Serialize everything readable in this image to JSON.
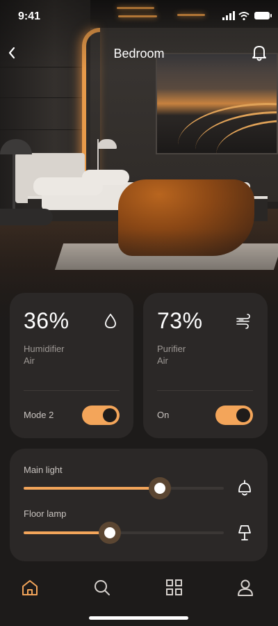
{
  "status_bar": {
    "time": "9:41"
  },
  "header": {
    "title": "Bedroom"
  },
  "devices": [
    {
      "value": "36%",
      "name_line1": "Humidifier",
      "name_line2": "Air",
      "icon": "droplet-icon",
      "mode_text": "Mode 2",
      "toggle_on": true
    },
    {
      "value": "73%",
      "name_line1": "Purifier",
      "name_line2": "Air",
      "icon": "wind-icon",
      "mode_text": "On",
      "toggle_on": true
    }
  ],
  "lights": [
    {
      "label": "Main light",
      "level_percent": 68,
      "icon": "ceiling-lamp-icon"
    },
    {
      "label": "Floor lamp",
      "level_percent": 43,
      "icon": "floor-lamp-icon"
    }
  ],
  "bottom_nav": [
    {
      "name": "home",
      "icon": "home-icon",
      "active": true
    },
    {
      "name": "search",
      "icon": "search-icon",
      "active": false
    },
    {
      "name": "apps",
      "icon": "grid-icon",
      "active": false
    },
    {
      "name": "profile",
      "icon": "user-icon",
      "active": false
    }
  ],
  "colors": {
    "accent": "#f3a55a",
    "card": "#2b2827",
    "background": "#1d1b1a",
    "inactive_icon": "#d7d2ce"
  }
}
